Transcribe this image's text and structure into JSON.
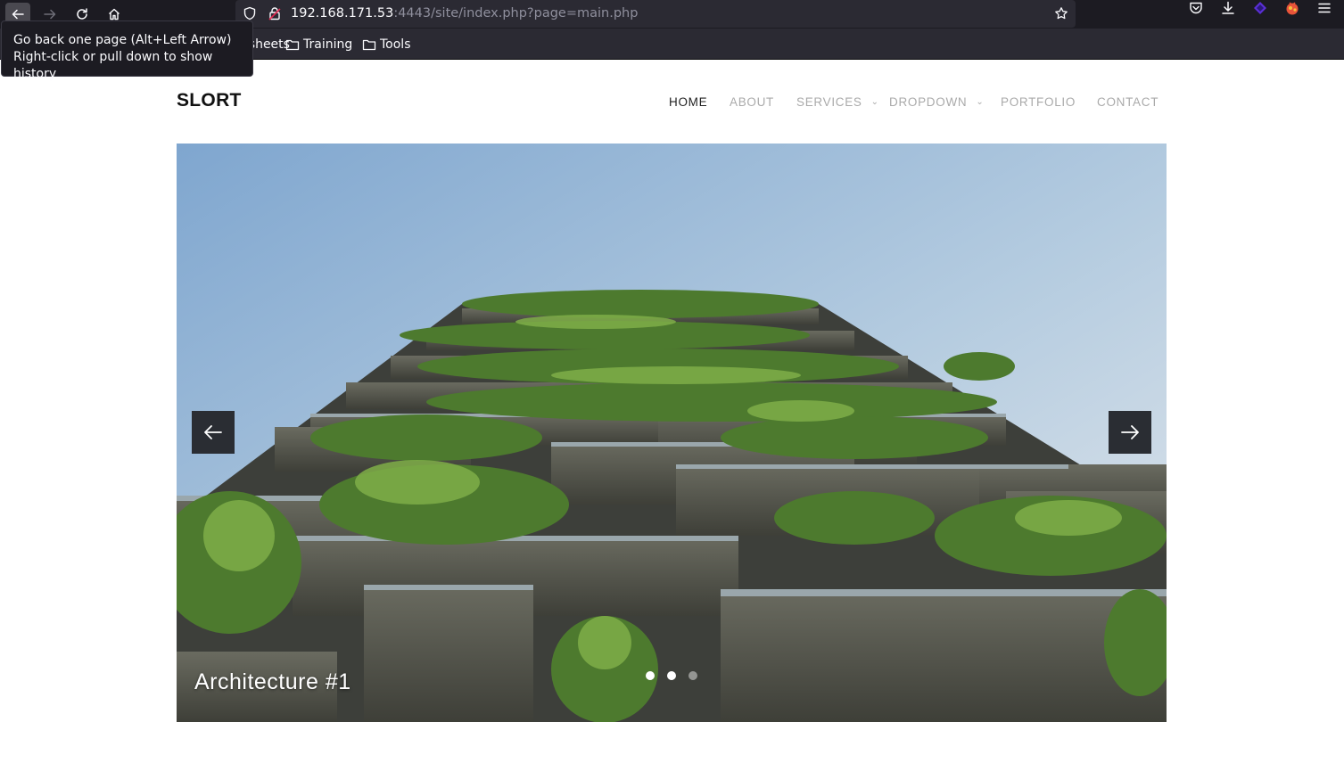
{
  "browser": {
    "url_host": "192.168.171.53",
    "url_rest": ":4443/site/index.php?page=main.php",
    "bookmarks": [
      "Cheat sheets",
      "Training",
      "Tools"
    ],
    "tooltip": {
      "line1": "Go back one page (Alt+Left Arrow)",
      "line2": "Right-click or pull down to show history"
    }
  },
  "site": {
    "brand": "SLORT",
    "nav": [
      {
        "label": "HOME"
      },
      {
        "label": "ABOUT"
      },
      {
        "label": "SERVICES"
      },
      {
        "label": "DROPDOWN"
      },
      {
        "label": "PORTFOLIO"
      },
      {
        "label": "CONTACT"
      }
    ],
    "slider": {
      "caption": "Architecture #1",
      "slide_count": 3,
      "active_slide": 1
    }
  },
  "icons": {
    "back": "arrow-left-icon",
    "forward": "arrow-right-icon",
    "reload": "reload-icon",
    "home": "home-icon",
    "shield": "shield-icon",
    "lock": "lock-icon",
    "bookmark": "star-icon",
    "pocket": "pocket-icon",
    "download": "download-icon",
    "extension1": "extension-icon",
    "extension2": "extension-icon",
    "menu": "hamburger-menu-icon",
    "folder": "folder-icon"
  },
  "colors": {
    "chrome_dark": "#1c1b22",
    "nav_active": "#222222",
    "nav_inactive": "#aaaaaa"
  }
}
